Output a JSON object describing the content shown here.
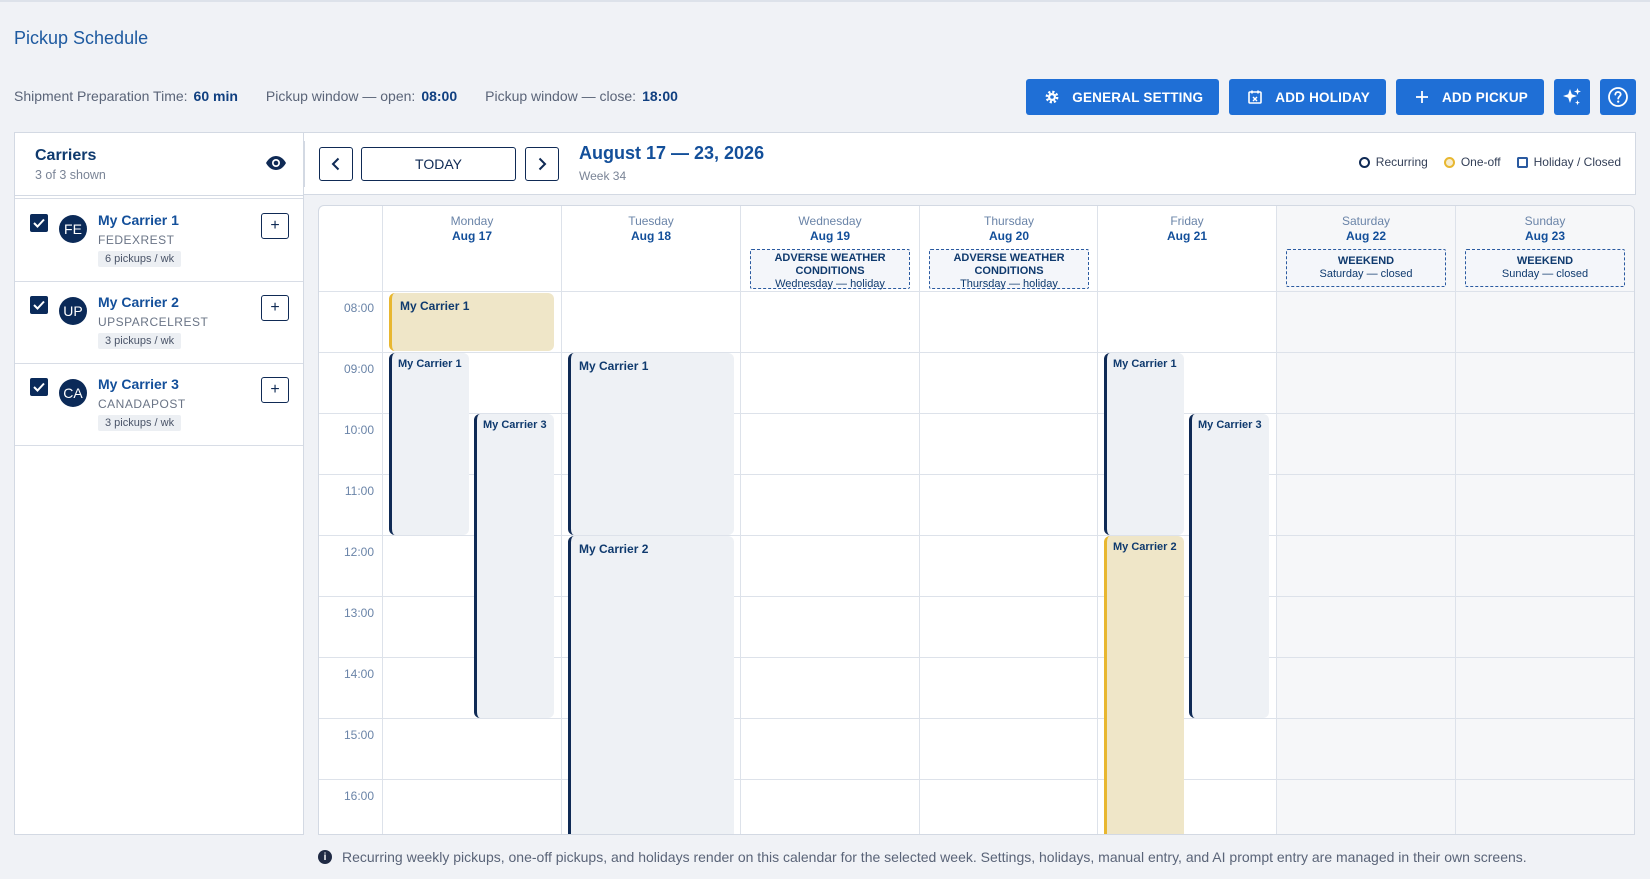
{
  "page": {
    "title": "Pickup Schedule"
  },
  "stats": {
    "prep_label": "Shipment Preparation Time:",
    "prep_value": "60 min",
    "open_label": "Pickup window — open:",
    "open_value": "08:00",
    "close_label": "Pickup window — close:",
    "close_value": "18:00"
  },
  "actions": {
    "general": "GENERAL SETTING",
    "holiday": "ADD HOLIDAY",
    "pickup": "ADD PICKUP"
  },
  "carriers": {
    "title": "Carriers",
    "subtitle": "3 of 3 shown",
    "items": [
      {
        "initials": "FE",
        "name": "My Carrier 1",
        "code": "FEDEXREST",
        "badge": "6 pickups / wk"
      },
      {
        "initials": "UP",
        "name": "My Carrier 2",
        "code": "UPSPARCELREST",
        "badge": "3 pickups / wk"
      },
      {
        "initials": "CA",
        "name": "My Carrier 3",
        "code": "CANADAPOST",
        "badge": "3 pickups / wk"
      }
    ]
  },
  "calendar": {
    "today": "TODAY",
    "range": "August 17 — 23, 2026",
    "week": "Week 34",
    "legend": {
      "recurring": "Recurring",
      "oneoff": "One-off",
      "holiday": "Holiday / Closed"
    },
    "days": [
      {
        "name": "Monday",
        "date": "Aug 17"
      },
      {
        "name": "Tuesday",
        "date": "Aug 18"
      },
      {
        "name": "Wednesday",
        "date": "Aug 19",
        "banner_title": "ADVERSE WEATHER CONDITIONS",
        "banner_sub": "Wednesday — holiday"
      },
      {
        "name": "Thursday",
        "date": "Aug 20",
        "banner_title": "ADVERSE WEATHER CONDITIONS",
        "banner_sub": "Thursday — holiday"
      },
      {
        "name": "Friday",
        "date": "Aug 21"
      },
      {
        "name": "Saturday",
        "date": "Aug 22",
        "banner_title": "WEEKEND",
        "banner_sub": "Saturday — closed"
      },
      {
        "name": "Sunday",
        "date": "Aug 23",
        "banner_title": "WEEKEND",
        "banner_sub": "Sunday — closed"
      }
    ],
    "times": [
      "08:00",
      "09:00",
      "10:00",
      "11:00",
      "12:00",
      "13:00",
      "14:00",
      "15:00",
      "16:00"
    ],
    "events": {
      "mon_c1_oneoff": "My Carrier 1",
      "mon_c1": "My Carrier 1",
      "mon_c3": "My Carrier 3",
      "tue_c1": "My Carrier 1",
      "tue_c2": "My Carrier 2",
      "fri_c1": "My Carrier 1",
      "fri_c3": "My Carrier 3",
      "fri_c2": "My Carrier 2"
    }
  },
  "footer": {
    "note": "Recurring weekly pickups, one-off pickups, and holidays render on this calendar for the selected week. Settings, holidays, manual entry, and AI prompt entry are managed in their own screens."
  },
  "colors": {
    "accent": "#1f6fd6",
    "navy": "#0f2a55",
    "oneoff": "#e8b730"
  }
}
